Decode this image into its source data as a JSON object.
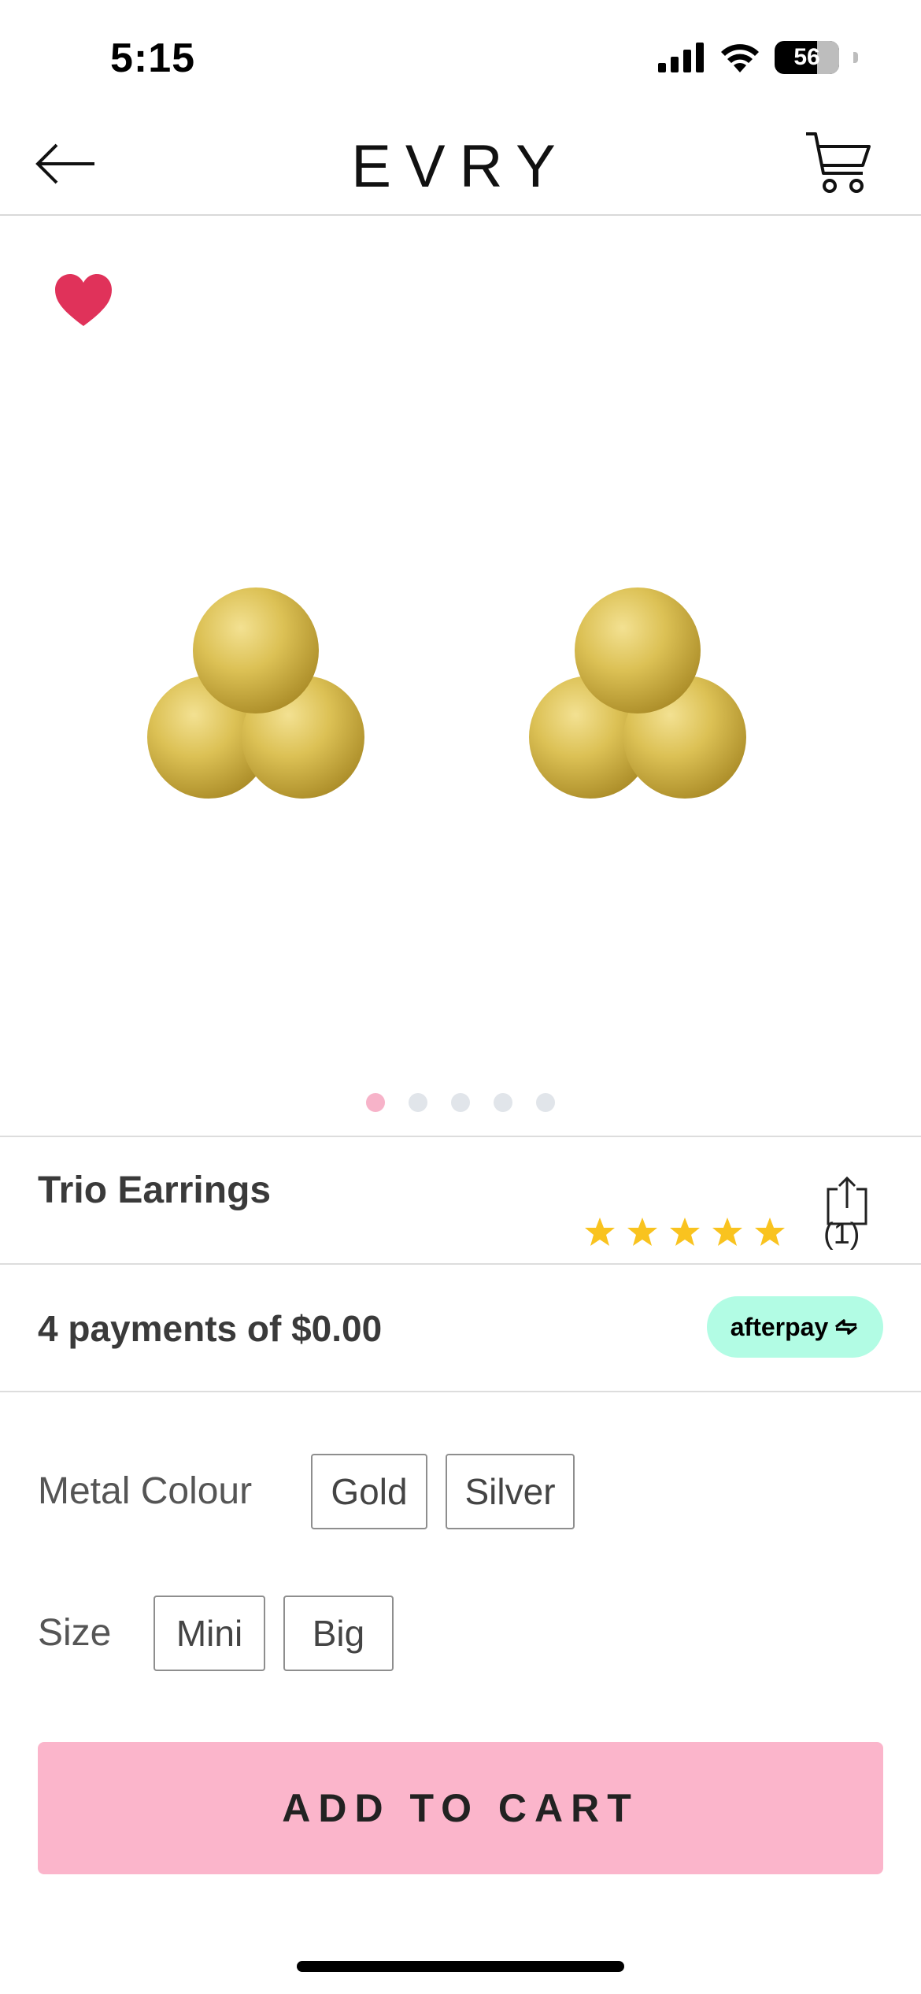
{
  "status_bar": {
    "time": "5:15",
    "battery": "56"
  },
  "header": {
    "logo": "EVRY"
  },
  "gallery": {
    "image_count": 5,
    "active_index": 0,
    "favorited": true
  },
  "product": {
    "title": "Trio Earrings",
    "rating": 5,
    "review_count": "(1)"
  },
  "payments": {
    "text": "4 payments of $0.00",
    "provider": "afterpay"
  },
  "options": {
    "metal": {
      "label": "Metal Colour",
      "values": [
        "Gold",
        "Silver"
      ]
    },
    "size": {
      "label": "Size",
      "values": [
        "Mini",
        "Big"
      ]
    }
  },
  "actions": {
    "add_to_cart": "ADD TO CART"
  },
  "colors": {
    "accent_pink": "#fbb5cb",
    "heart_red": "#e0325a",
    "afterpay_mint": "#b2fce4",
    "star_gold": "#f9c31f",
    "dot_active": "#f7b3c9",
    "dot_inactive": "#e1e5ea"
  },
  "icons": [
    "back-arrow-icon",
    "cart-icon",
    "heart-icon",
    "star-icon",
    "share-icon",
    "afterpay-logo-icon"
  ]
}
